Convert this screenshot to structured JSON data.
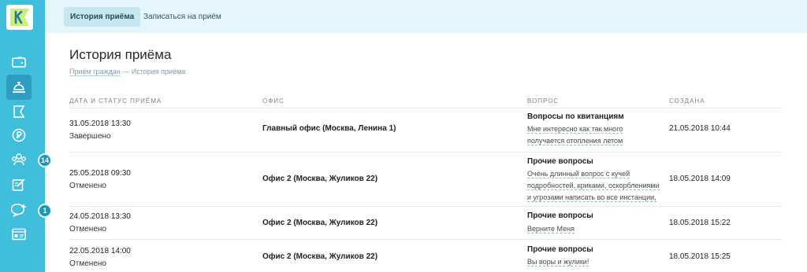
{
  "brand": {
    "logo_letter": "K"
  },
  "sidebar": {
    "items": [
      {
        "icon": "wallet-icon",
        "active": false
      },
      {
        "icon": "reception-bell-icon",
        "active": true
      },
      {
        "icon": "flag-icon",
        "active": false
      },
      {
        "icon": "coin-icon",
        "active": false
      },
      {
        "icon": "people-group-icon",
        "active": false,
        "badge": "14"
      },
      {
        "icon": "edit-note-icon",
        "active": false
      },
      {
        "icon": "chat-add-icon",
        "active": false,
        "badge": "1"
      },
      {
        "icon": "id-card-icon",
        "active": false
      }
    ]
  },
  "tabs": [
    {
      "label": "История приёма",
      "active": true
    },
    {
      "label": "Записаться на приём",
      "active": false
    }
  ],
  "page": {
    "title": "История приёма",
    "breadcrumb_link": "Приём граждан",
    "breadcrumb_sep": "—",
    "breadcrumb_current": "История приёма"
  },
  "table": {
    "headers": [
      "Дата и статус приёма",
      "Офис",
      "Вопрос",
      "Создана"
    ],
    "rows": [
      {
        "date": "31.05.2018 13:30",
        "status": "Завершено",
        "office": "Главный офис (Москва, Ленина 1)",
        "question_title": "Вопросы по квитанциям",
        "question_lines": [
          "Мне интересно как так много",
          "получается отопления летом"
        ],
        "created": "21.05.2018 10:44"
      },
      {
        "date": "25.05.2018 09:30",
        "status": "Отменено",
        "office": "Офис 2 (Москва, Жуликов 22)",
        "question_title": "Прочие вопросы",
        "question_lines": [
          "Очень длинный вопрос с кучей",
          "подробностей, криками, оскорблениями",
          "и угрозами написать во все инстанции,"
        ],
        "created": "18.05.2018 14:09"
      },
      {
        "date": "24.05.2018 13:30",
        "status": "Отменено",
        "office": "Офис 2 (Москва, Жуликов 22)",
        "question_title": "Прочие вопросы",
        "question_lines": [
          "Верните Меня"
        ],
        "created": "18.05.2018 15:22"
      },
      {
        "date": "22.05.2018 14:00",
        "status": "Отменено",
        "office": "Офис 2 (Москва, Жуликов 22)",
        "question_title": "Прочие вопросы",
        "question_lines": [
          "Вы воры и жулики!"
        ],
        "created": "18.05.2018 15:25"
      }
    ]
  }
}
